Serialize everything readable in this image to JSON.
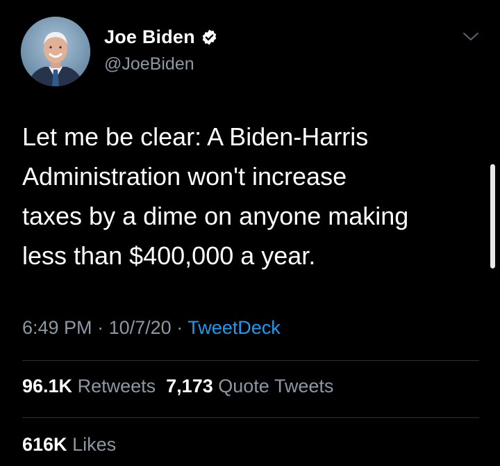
{
  "author": {
    "display_name": "Joe Biden",
    "handle": "@JoeBiden",
    "verified": true,
    "avatar": "profile-photo"
  },
  "tweet": {
    "lines": [
      "Let me be clear: A Biden-Harris",
      "Administration won't increase",
      "taxes by a dime on anyone making",
      "less than $400,000 a year."
    ],
    "time": "6:49 PM",
    "separator": "·",
    "date": "10/7/20",
    "source": "TweetDeck"
  },
  "stats": {
    "retweets_count": "96.1K",
    "retweets_label": "Retweets",
    "quote_count": "7,173",
    "quote_label": "Quote Tweets",
    "likes_count": "616K",
    "likes_label": "Likes"
  },
  "colors": {
    "background": "#000000",
    "secondary_text": "#8b98a5",
    "link": "#1d9bf0",
    "divider": "#2f3336"
  },
  "icons": [
    "verified-badge-icon",
    "chevron-down-icon"
  ]
}
